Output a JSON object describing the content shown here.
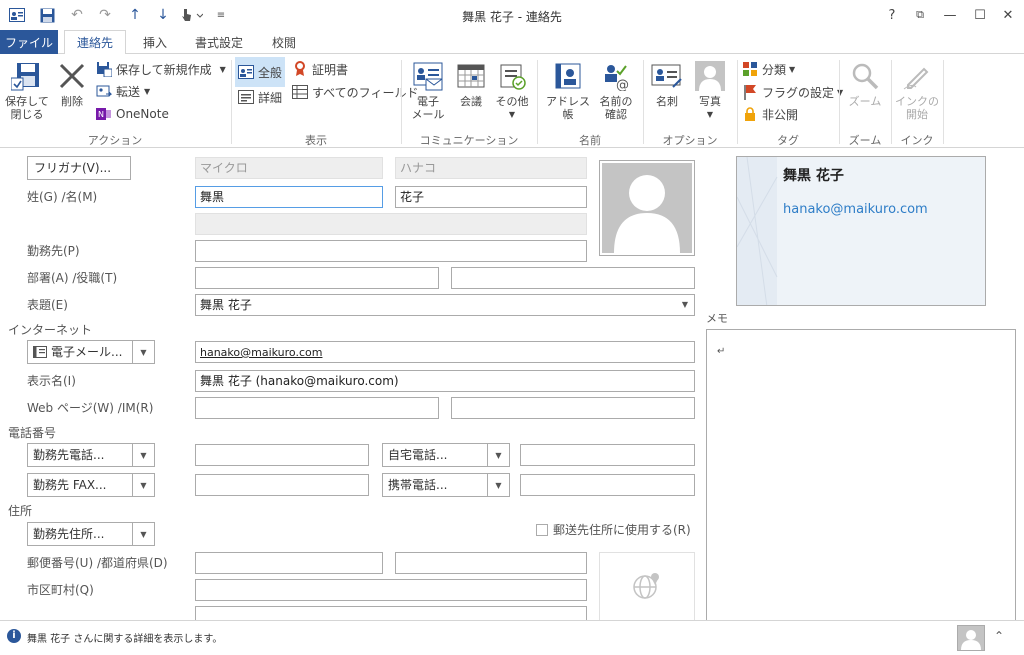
{
  "window": {
    "title": "舞黒 花子 - 連絡先",
    "help": "?",
    "restore": "⧉",
    "minimize": "—",
    "maximize": "☐",
    "close": "✕"
  },
  "tabs": [
    "ファイル",
    "連絡先",
    "挿入",
    "書式設定",
    "校閲"
  ],
  "ribbon": {
    "action": {
      "save_close": "保存して閉じる",
      "save_close_l1": "保存して",
      "save_close_l2": "閉じる",
      "delete": "削除",
      "save_new": "保存して新規作成",
      "forward": "転送",
      "onenote": "OneNote",
      "label": "アクション"
    },
    "show": {
      "general": "全般",
      "details": "詳細",
      "certificates": "証明書",
      "all_fields": "すべてのフィールド",
      "label": "表示"
    },
    "communicate": {
      "email_l1": "電子",
      "email_l2": "メール",
      "meeting": "会議",
      "more": "その他",
      "label": "コミュニケーション"
    },
    "names": {
      "address_book": "アドレス帳",
      "check_l1": "名前の",
      "check_l2": "確認",
      "label": "名前"
    },
    "options": {
      "business_card": "名刺",
      "picture": "写真",
      "label": "オプション"
    },
    "tags": {
      "categorize": "分類",
      "follow_up": "フラグの設定",
      "private": "非公開",
      "label": "タグ"
    },
    "zoom": {
      "zoom": "ズーム",
      "label": "ズーム"
    },
    "ink": {
      "start_l1": "インクの",
      "start_l2": "開始",
      "label": "インク"
    }
  },
  "form": {
    "furigana_button": "フリガナ(V)...",
    "furigana_last": "マイクロ",
    "furigana_first": "ハナコ",
    "name_label": "姓(G)  /名(M)",
    "last_name": "舞黒",
    "first_name": "花子",
    "company_label": "勤務先(P)",
    "dept_label": "部署(A)  /役職(T)",
    "fileas_label": "表題(E)",
    "fileas_value": "舞黒 花子",
    "internet_section": "インターネット",
    "email_button": "電子メール...",
    "email_value": "hanako@maikuro.com",
    "display_label": "表示名(I)",
    "display_value": "舞黒 花子 (hanako@maikuro.com)",
    "web_label": "Web ページ(W)  /IM(R)",
    "phone_section": "電話番号",
    "phone_business": "勤務先電話...",
    "phone_home": "自宅電話...",
    "phone_fax": "勤務先 FAX...",
    "phone_mobile": "携帯電話...",
    "address_section": "住所",
    "address_button": "勤務先住所...",
    "mailing_checkbox": "郵送先住所に使用する(R)",
    "postal_label": "郵便番号(U)  /都道府県(D)",
    "city_label": "市区町村(Q)"
  },
  "card": {
    "name": "舞黒 花子",
    "email": "hanako@maikuro.com"
  },
  "memo": {
    "label": "メモ",
    "mark": "↵"
  },
  "status": {
    "text": "舞黒 花子 さんに関する詳細を表示します。"
  },
  "colors": {
    "accent": "#2b579a",
    "link": "#2e7dc7"
  }
}
